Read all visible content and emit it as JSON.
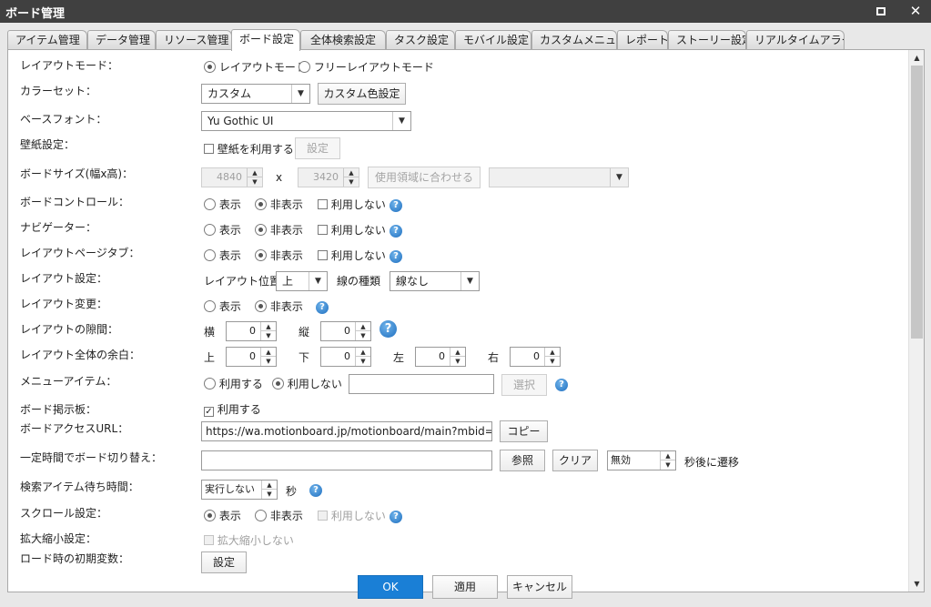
{
  "window": {
    "title": "ボード管理",
    "maximize_icon": "maximize-icon",
    "close_icon": "close-icon",
    "close_glyph": "✕"
  },
  "tabs": [
    {
      "label": "アイテム管理"
    },
    {
      "label": "データ管理"
    },
    {
      "label": "リソース管理"
    },
    {
      "label": "ボード設定",
      "active": true
    },
    {
      "label": "全体検索設定"
    },
    {
      "label": "タスク設定"
    },
    {
      "label": "モバイル設定"
    },
    {
      "label": "カスタムメニュー"
    },
    {
      "label": "レポート"
    },
    {
      "label": "ストーリー設定"
    },
    {
      "label": "リアルタイムアラート"
    }
  ],
  "settings": {
    "layout_mode": {
      "label": "レイアウトモード：",
      "opt1": "レイアウトモード",
      "opt2": "フリーレイアウトモード",
      "selected": "opt1"
    },
    "color_set": {
      "label": "カラーセット：",
      "value": "カスタム",
      "button": "カスタム色設定"
    },
    "base_font": {
      "label": "ベースフォント：",
      "value": "Yu Gothic UI"
    },
    "wallpaper": {
      "label": "壁紙設定：",
      "check_label": "壁紙を利用する",
      "button": "設定"
    },
    "board_size": {
      "label": "ボードサイズ(幅x高)：",
      "width": "4840",
      "x": "x",
      "height": "3420",
      "fit_button": "使用領域に合わせる",
      "select_value": ""
    },
    "board_control": {
      "label": "ボードコントロール：",
      "show": "表示",
      "hide": "非表示",
      "unused": "利用しない"
    },
    "navigator": {
      "label": "ナビゲーター：",
      "show": "表示",
      "hide": "非表示",
      "unused": "利用しない"
    },
    "layout_page_tab": {
      "label": "レイアウトページタブ：",
      "show": "表示",
      "hide": "非表示",
      "unused": "利用しない"
    },
    "layout_setting": {
      "label": "レイアウト設定：",
      "position_label": "レイアウト位置",
      "position_value": "上",
      "line_label": "線の種類",
      "line_value": "線なし"
    },
    "layout_change": {
      "label": "レイアウト変更：",
      "show": "表示",
      "hide": "非表示"
    },
    "layout_gap": {
      "label": "レイアウトの隙間：",
      "h_label": "横",
      "h_value": "0",
      "v_label": "縦",
      "v_value": "0"
    },
    "layout_margin": {
      "label": "レイアウト全体の余白：",
      "top_label": "上",
      "top_value": "0",
      "bottom_label": "下",
      "bottom_value": "0",
      "left_label": "左",
      "left_value": "0",
      "right_label": "右",
      "right_value": "0"
    },
    "menu_item": {
      "label": "メニューアイテム：",
      "use": "利用する",
      "unused": "利用しない",
      "select_button": "選択"
    },
    "board_bbs": {
      "label": "ボード掲示板：",
      "check_label": "利用する",
      "check_glyph": "✓"
    },
    "access_url": {
      "label": "ボードアクセスURL：",
      "value": "https://wa.motionboard.jp/motionboard/main?mbid=fidbmp5ha",
      "copy_button": "コピー"
    },
    "auto_switch": {
      "label": "一定時間でボード切り替え：",
      "ref_button": "参照",
      "clear_button": "クリア",
      "interval_value": "無効",
      "suffix": "秒後に遷移"
    },
    "search_wait": {
      "label": "検索アイテム待ち時間：",
      "value": "実行しない",
      "unit": "秒"
    },
    "scroll": {
      "label": "スクロール設定：",
      "show": "表示",
      "hide": "非表示",
      "unused": "利用しない"
    },
    "zoom": {
      "label": "拡大縮小設定：",
      "check_label": "拡大縮小しない"
    },
    "init_vars": {
      "label": "ロード時の初期変数：",
      "button": "設定"
    }
  },
  "footer": {
    "ok": "OK",
    "apply": "適用",
    "cancel": "キャンセル"
  },
  "colors": {
    "titlebar": "#404040",
    "primary": "#1a7fd6",
    "help": "#1f6fc0"
  }
}
